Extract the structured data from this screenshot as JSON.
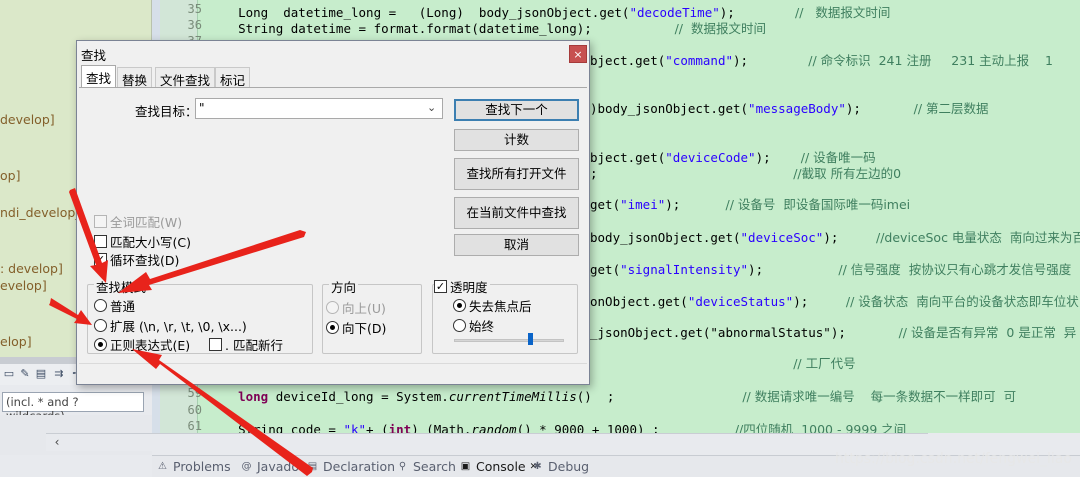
{
  "left_panel": {
    "items": [
      "develop]",
      "op]",
      "ndi_develop_",
      ": develop]",
      "evelop]",
      "elop]"
    ],
    "filter_placeholder": "(incl. * and ? wildcards)"
  },
  "editor": {
    "line_numbers": [
      "35",
      "36",
      "37",
      "",
      "",
      "",
      "",
      "",
      "",
      "",
      "",
      "",
      "",
      "",
      "",
      "",
      "",
      "",
      "",
      "59",
      "60",
      "61"
    ],
    "lines": [
      {
        "ln": "35",
        "parts": [
          [
            "",
            "    Long  datetime_long =   (Long)  body_jsonObject.get("
          ],
          [
            "str",
            "\"decodeTime\""
          ],
          [
            "",
            ");        "
          ],
          [
            "cmt",
            "//   数据报文时间"
          ]
        ]
      },
      {
        "ln": "36",
        "parts": [
          [
            "",
            "    String datetime = format.format(datetime_long);           "
          ],
          [
            "cmt",
            "//  数据报文时间"
          ]
        ]
      }
    ],
    "snippets": [
      {
        "id": "s37",
        "parts": [
          [
            "",
            "bject.get("
          ],
          [
            "str",
            "\"command\""
          ],
          [
            "",
            ");        "
          ],
          [
            "cmt",
            "// 命令标识  241 注册     231 主动上报    1"
          ]
        ]
      },
      {
        "id": "s38",
        "parts": [
          [
            "",
            ")body_jsonObject.get("
          ],
          [
            "str",
            "\"messageBody\""
          ],
          [
            "",
            ");       "
          ],
          [
            "cmt",
            "// 第二层数据"
          ]
        ]
      },
      {
        "id": "s39",
        "parts": [
          [
            "",
            "bject.get("
          ],
          [
            "str",
            "\"deviceCode\""
          ],
          [
            "",
            ");    "
          ],
          [
            "cmt",
            "// 设备唯一码"
          ]
        ]
      },
      {
        "id": "s40",
        "parts": [
          [
            "",
            ";                          "
          ],
          [
            "cmt",
            "//截取 所有左边的0"
          ]
        ]
      },
      {
        "id": "s41",
        "parts": [
          [
            "",
            "get("
          ],
          [
            "str",
            "\"imei\""
          ],
          [
            "",
            ");      "
          ],
          [
            "cmt",
            "// 设备号  即设备国际唯一码imei"
          ]
        ]
      },
      {
        "id": "s42",
        "parts": [
          [
            "",
            "body_jsonObject.get("
          ],
          [
            "str",
            "\"deviceSoc\""
          ],
          [
            "",
            ");     "
          ],
          [
            "cmt",
            "//deviceSoc 电量状态  南向过来为百分"
          ]
        ]
      },
      {
        "id": "s43",
        "parts": [
          [
            "",
            "get("
          ],
          [
            "str",
            "\"signalIntensity\""
          ],
          [
            "",
            ");          "
          ],
          [
            "cmt",
            "// 信号强度  按协议只有心跳才发信号强度"
          ]
        ]
      },
      {
        "id": "s44",
        "parts": [
          [
            "",
            "onObject.get("
          ],
          [
            "str",
            "\"deviceStatus\""
          ],
          [
            "",
            ");     "
          ],
          [
            "cmt",
            "// 设备状态  南向平台的设备状态即车位状"
          ]
        ]
      },
      {
        "id": "s45",
        "parts": [
          [
            "",
            "_jsonObject.get(\"abnormalStatus\");       "
          ],
          [
            "cmt",
            "// 设备是否有异常  0 是正常  异"
          ]
        ]
      },
      {
        "id": "s46",
        "parts": [
          [
            "",
            "                           "
          ],
          [
            "cmt",
            "// 工厂代号"
          ]
        ]
      }
    ],
    "tail_lines": [
      {
        "ln": "59",
        "parts": [
          [
            "kw",
            "    long "
          ],
          [
            "",
            "deviceId_long = System."
          ],
          [
            "it",
            "currentTimeMillis"
          ],
          [
            "",
            "()  ;                 "
          ],
          [
            "cmt",
            "// 数据请求唯一编号    每一条数据不一样即可  可"
          ]
        ]
      },
      {
        "ln": "60",
        "parts": [
          [
            "",
            ""
          ]
        ]
      },
      {
        "ln": "61",
        "parts": [
          [
            "",
            "    String code = "
          ],
          [
            "str",
            "\"k\""
          ],
          [
            "",
            "+ ("
          ],
          [
            "kw",
            "int"
          ],
          [
            "",
            ") (Math."
          ],
          [
            "it",
            "random"
          ],
          [
            "",
            "() * 9000 + 1000) ;          "
          ],
          [
            "cmt",
            "//四位随机  1000 - 9999 之间"
          ]
        ]
      }
    ]
  },
  "bottom_tabs": [
    {
      "label": "Problems",
      "icon": "problems-icon",
      "active": false
    },
    {
      "label": "Javadoc",
      "icon": "javadoc-icon",
      "active": false
    },
    {
      "label": "Declaration",
      "icon": "declaration-icon",
      "active": false
    },
    {
      "label": "Search",
      "icon": "search-icon",
      "active": false
    },
    {
      "label": "Console",
      "icon": "console-icon",
      "active": true
    },
    {
      "label": "Debug",
      "icon": "debug-icon",
      "active": false
    }
  ],
  "watermark": "https://blog.csdn.net/fengwei_liao",
  "dialog": {
    "title": "查找",
    "close": "×",
    "tabs": [
      "查找",
      "替换",
      "文件查找",
      "标记"
    ],
    "target_label": "查找目标：",
    "target_value": "\"",
    "buttons": {
      "find_next": "查找下一个",
      "count": "计数",
      "find_all_open": "查找所有打开文件",
      "find_current": "在当前文件中查找",
      "cancel": "取消"
    },
    "options": {
      "whole_word": "全词匹配(W)",
      "match_case": "匹配大小写(C)",
      "wrap": "循环查找(D)"
    },
    "mode_group": {
      "title": "查找模式",
      "normal": "普通",
      "extended": "扩展 (\\n, \\r, \\t, \\0, \\x...)",
      "regex": "正则表达式(E)",
      "dot_newline": ". 匹配新行"
    },
    "direction_group": {
      "title": "方向",
      "up": "向上(U)",
      "down": "向下(D)"
    },
    "transparency_group": {
      "title": "透明度",
      "on_lose_focus": "失去焦点后",
      "always": "始终",
      "slider_fraction": 0.7
    }
  },
  "colors": {
    "editor_bg": "#c7edcc",
    "arrow_red": "#e8231b",
    "keyword": "#7f0055",
    "string": "#2a00ff",
    "comment": "#3f7f5f"
  }
}
